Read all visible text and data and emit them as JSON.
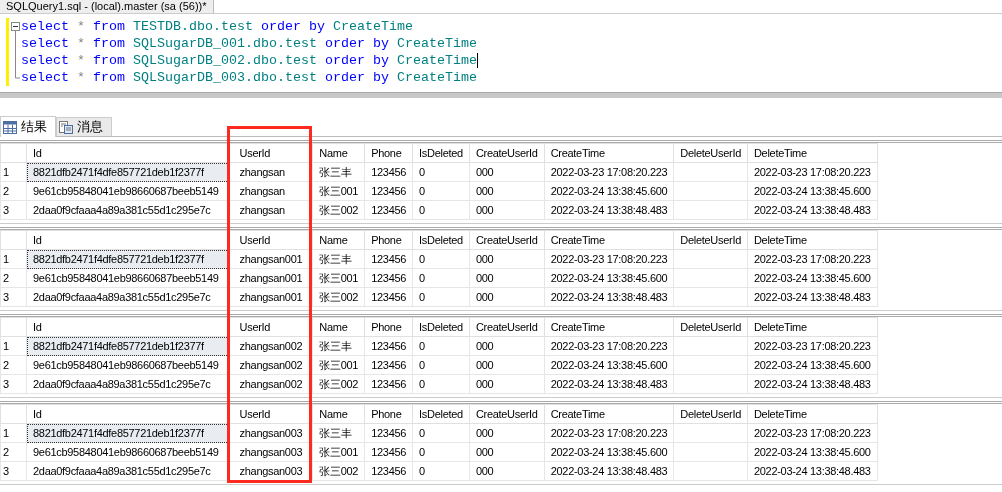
{
  "document_tab": {
    "title": "SQLQuery1.sql - (local).master (sa (56))*"
  },
  "editor": {
    "lines": [
      {
        "caret_at_end": false,
        "tokens": [
          {
            "kind": "keyword",
            "text": "select"
          },
          {
            "kind": "operator",
            "text": "*"
          },
          {
            "kind": "keyword",
            "text": "from"
          },
          {
            "kind": "identifier",
            "text": "TESTDB.dbo.test"
          },
          {
            "kind": "keyword",
            "text": "order"
          },
          {
            "kind": "keyword",
            "text": "by"
          },
          {
            "kind": "identifier",
            "text": "CreateTime"
          }
        ]
      },
      {
        "caret_at_end": false,
        "tokens": [
          {
            "kind": "keyword",
            "text": "select"
          },
          {
            "kind": "operator",
            "text": "*"
          },
          {
            "kind": "keyword",
            "text": "from"
          },
          {
            "kind": "identifier",
            "text": "SQLSugarDB_001.dbo.test"
          },
          {
            "kind": "keyword",
            "text": "order"
          },
          {
            "kind": "keyword",
            "text": "by"
          },
          {
            "kind": "identifier",
            "text": "CreateTime"
          }
        ]
      },
      {
        "caret_at_end": true,
        "tokens": [
          {
            "kind": "keyword",
            "text": "select"
          },
          {
            "kind": "operator",
            "text": "*"
          },
          {
            "kind": "keyword",
            "text": "from"
          },
          {
            "kind": "identifier",
            "text": "SQLSugarDB_002.dbo.test"
          },
          {
            "kind": "keyword",
            "text": "order"
          },
          {
            "kind": "keyword",
            "text": "by"
          },
          {
            "kind": "identifier",
            "text": "CreateTime"
          }
        ]
      },
      {
        "caret_at_end": false,
        "tokens": [
          {
            "kind": "keyword",
            "text": "select"
          },
          {
            "kind": "operator",
            "text": "*"
          },
          {
            "kind": "keyword",
            "text": "from"
          },
          {
            "kind": "identifier",
            "text": "SQLSugarDB_003.dbo.test"
          },
          {
            "kind": "keyword",
            "text": "order"
          },
          {
            "kind": "keyword",
            "text": "by"
          },
          {
            "kind": "identifier",
            "text": "CreateTime"
          }
        ]
      }
    ]
  },
  "result_tabs": [
    {
      "label": "结果",
      "kind": "grid",
      "selected": true
    },
    {
      "label": "消息",
      "kind": "messages",
      "selected": false
    }
  ],
  "grids": [
    {
      "columns": [
        "Id",
        "UserId",
        "Name",
        "Phone",
        "IsDeleted",
        "CreateUserId",
        "CreateTime",
        "DeleteUserId",
        "DeleteTime"
      ],
      "rows": [
        {
          "number": "1",
          "id_focused": true,
          "cells": [
            "8821dfb2471f4dfe857721deb1f2377f",
            "zhangsan",
            "张三丰",
            "123456",
            "0",
            "000",
            "2022-03-23 17:08:20.223",
            "",
            "2022-03-23 17:08:20.223"
          ]
        },
        {
          "number": "2",
          "id_focused": false,
          "cells": [
            "9e61cb95848041eb98660687beeb5149",
            "zhangsan",
            "张三001",
            "123456",
            "0",
            "000",
            "2022-03-24 13:38:45.600",
            "",
            "2022-03-24 13:38:45.600"
          ]
        },
        {
          "number": "3",
          "id_focused": false,
          "cells": [
            "2daa0f9cfaaa4a89a381c55d1c295e7c",
            "zhangsan",
            "张三002",
            "123456",
            "0",
            "000",
            "2022-03-24 13:38:48.483",
            "",
            "2022-03-24 13:38:48.483"
          ]
        }
      ]
    },
    {
      "columns": [
        "Id",
        "UserId",
        "Name",
        "Phone",
        "IsDeleted",
        "CreateUserId",
        "CreateTime",
        "DeleteUserId",
        "DeleteTime"
      ],
      "rows": [
        {
          "number": "1",
          "id_focused": true,
          "cells": [
            "8821dfb2471f4dfe857721deb1f2377f",
            "zhangsan001",
            "张三丰",
            "123456",
            "0",
            "000",
            "2022-03-23 17:08:20.223",
            "",
            "2022-03-23 17:08:20.223"
          ]
        },
        {
          "number": "2",
          "id_focused": false,
          "cells": [
            "9e61cb95848041eb98660687beeb5149",
            "zhangsan001",
            "张三001",
            "123456",
            "0",
            "000",
            "2022-03-24 13:38:45.600",
            "",
            "2022-03-24 13:38:45.600"
          ]
        },
        {
          "number": "3",
          "id_focused": false,
          "cells": [
            "2daa0f9cfaaa4a89a381c55d1c295e7c",
            "zhangsan001",
            "张三002",
            "123456",
            "0",
            "000",
            "2022-03-24 13:38:48.483",
            "",
            "2022-03-24 13:38:48.483"
          ]
        }
      ]
    },
    {
      "columns": [
        "Id",
        "UserId",
        "Name",
        "Phone",
        "IsDeleted",
        "CreateUserId",
        "CreateTime",
        "DeleteUserId",
        "DeleteTime"
      ],
      "rows": [
        {
          "number": "1",
          "id_focused": true,
          "cells": [
            "8821dfb2471f4dfe857721deb1f2377f",
            "zhangsan002",
            "张三丰",
            "123456",
            "0",
            "000",
            "2022-03-23 17:08:20.223",
            "",
            "2022-03-23 17:08:20.223"
          ]
        },
        {
          "number": "2",
          "id_focused": false,
          "cells": [
            "9e61cb95848041eb98660687beeb5149",
            "zhangsan002",
            "张三001",
            "123456",
            "0",
            "000",
            "2022-03-24 13:38:45.600",
            "",
            "2022-03-24 13:38:45.600"
          ]
        },
        {
          "number": "3",
          "id_focused": false,
          "cells": [
            "2daa0f9cfaaa4a89a381c55d1c295e7c",
            "zhangsan002",
            "张三002",
            "123456",
            "0",
            "000",
            "2022-03-24 13:38:48.483",
            "",
            "2022-03-24 13:38:48.483"
          ]
        }
      ]
    },
    {
      "columns": [
        "Id",
        "UserId",
        "Name",
        "Phone",
        "IsDeleted",
        "CreateUserId",
        "CreateTime",
        "DeleteUserId",
        "DeleteTime"
      ],
      "rows": [
        {
          "number": "1",
          "id_focused": true,
          "cells": [
            "8821dfb2471f4dfe857721deb1f2377f",
            "zhangsan003",
            "张三丰",
            "123456",
            "0",
            "000",
            "2022-03-23 17:08:20.223",
            "",
            "2022-03-23 17:08:20.223"
          ]
        },
        {
          "number": "2",
          "id_focused": false,
          "cells": [
            "9e61cb95848041eb98660687beeb5149",
            "zhangsan003",
            "张三001",
            "123456",
            "0",
            "000",
            "2022-03-24 13:38:45.600",
            "",
            "2022-03-24 13:38:45.600"
          ]
        },
        {
          "number": "3",
          "id_focused": false,
          "cells": [
            "2daa0f9cfaaa4a89a381c55d1c295e7c",
            "zhangsan003",
            "张三002",
            "123456",
            "0",
            "000",
            "2022-03-24 13:38:48.483",
            "",
            "2022-03-24 13:38:48.483"
          ]
        }
      ]
    }
  ]
}
